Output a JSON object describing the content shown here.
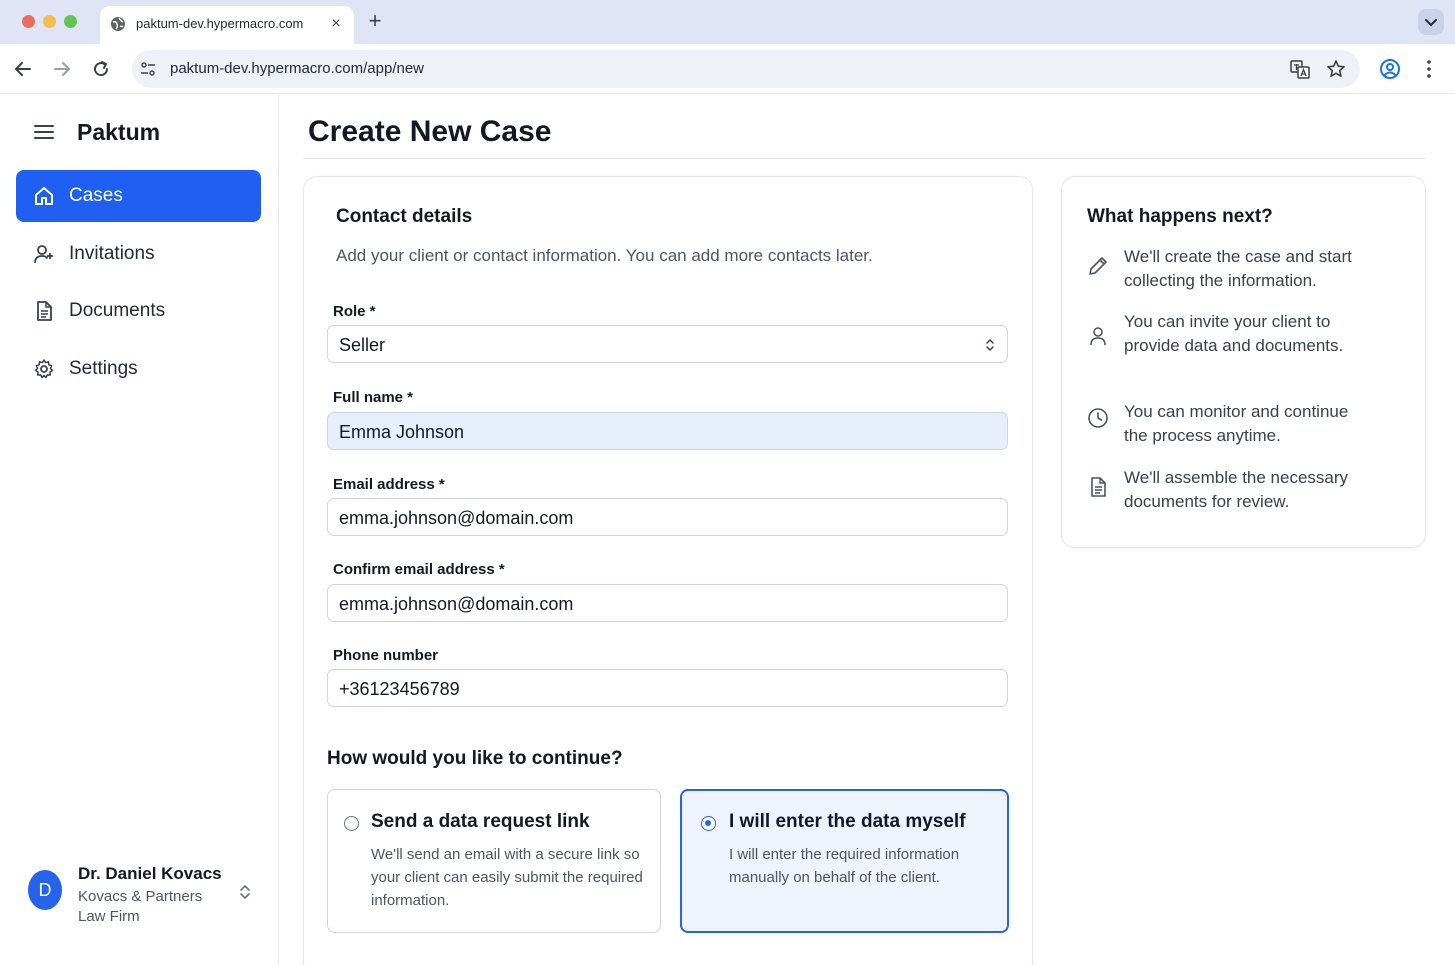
{
  "browser": {
    "tab_title": "paktum-dev.hypermacro.com",
    "new_tab_label": "+",
    "close_label": "×",
    "url": "paktum-dev.hypermacro.com/app/new"
  },
  "sidebar": {
    "brand": "Paktum",
    "items": [
      {
        "label": "Cases",
        "icon": "home-icon",
        "active": true
      },
      {
        "label": "Invitations",
        "icon": "user-plus-icon",
        "active": false
      },
      {
        "label": "Documents",
        "icon": "document-icon",
        "active": false
      },
      {
        "label": "Settings",
        "icon": "gear-icon",
        "active": false
      }
    ],
    "user": {
      "initial": "D",
      "name": "Dr. Daniel Kovacs",
      "org": "Kovacs & Partners Law Firm"
    }
  },
  "main": {
    "title": "Create New Case",
    "contact": {
      "heading": "Contact details",
      "subtitle": "Add your client or contact information. You can add more contacts later.",
      "fields": {
        "role": {
          "label": "Role *",
          "value": "Seller"
        },
        "full_name": {
          "label": "Full name *",
          "value": "Emma Johnson"
        },
        "email": {
          "label": "Email address *",
          "value": "emma.johnson@domain.com"
        },
        "confirm_email": {
          "label": "Confirm email address *",
          "value": "emma.johnson@domain.com"
        },
        "phone": {
          "label": "Phone number",
          "value": "+36123456789"
        }
      }
    },
    "continue": {
      "question": "How would you like to continue?",
      "options": [
        {
          "title": "Send a data request link",
          "description": "We'll send an email with a secure link so your client can easily submit the required information.",
          "selected": false
        },
        {
          "title": "I will enter the data myself",
          "description": "I will enter the required information manually on behalf of the client.",
          "selected": true
        }
      ]
    }
  },
  "next_steps": {
    "heading": "What happens next?",
    "items": [
      {
        "icon": "pencil-icon",
        "text": "We'll create the case and start collecting the information."
      },
      {
        "icon": "person-icon",
        "text": "You can invite your client to provide data and documents."
      },
      {
        "icon": "clock-icon",
        "text": "You can monitor and continue the process anytime."
      },
      {
        "icon": "document-icon",
        "text": "We'll assemble the necessary documents for review."
      }
    ]
  },
  "colors": {
    "accent": "#1f5ff1",
    "selected_bg": "#eef3fe",
    "filled_input_bg": "#e8effc"
  }
}
